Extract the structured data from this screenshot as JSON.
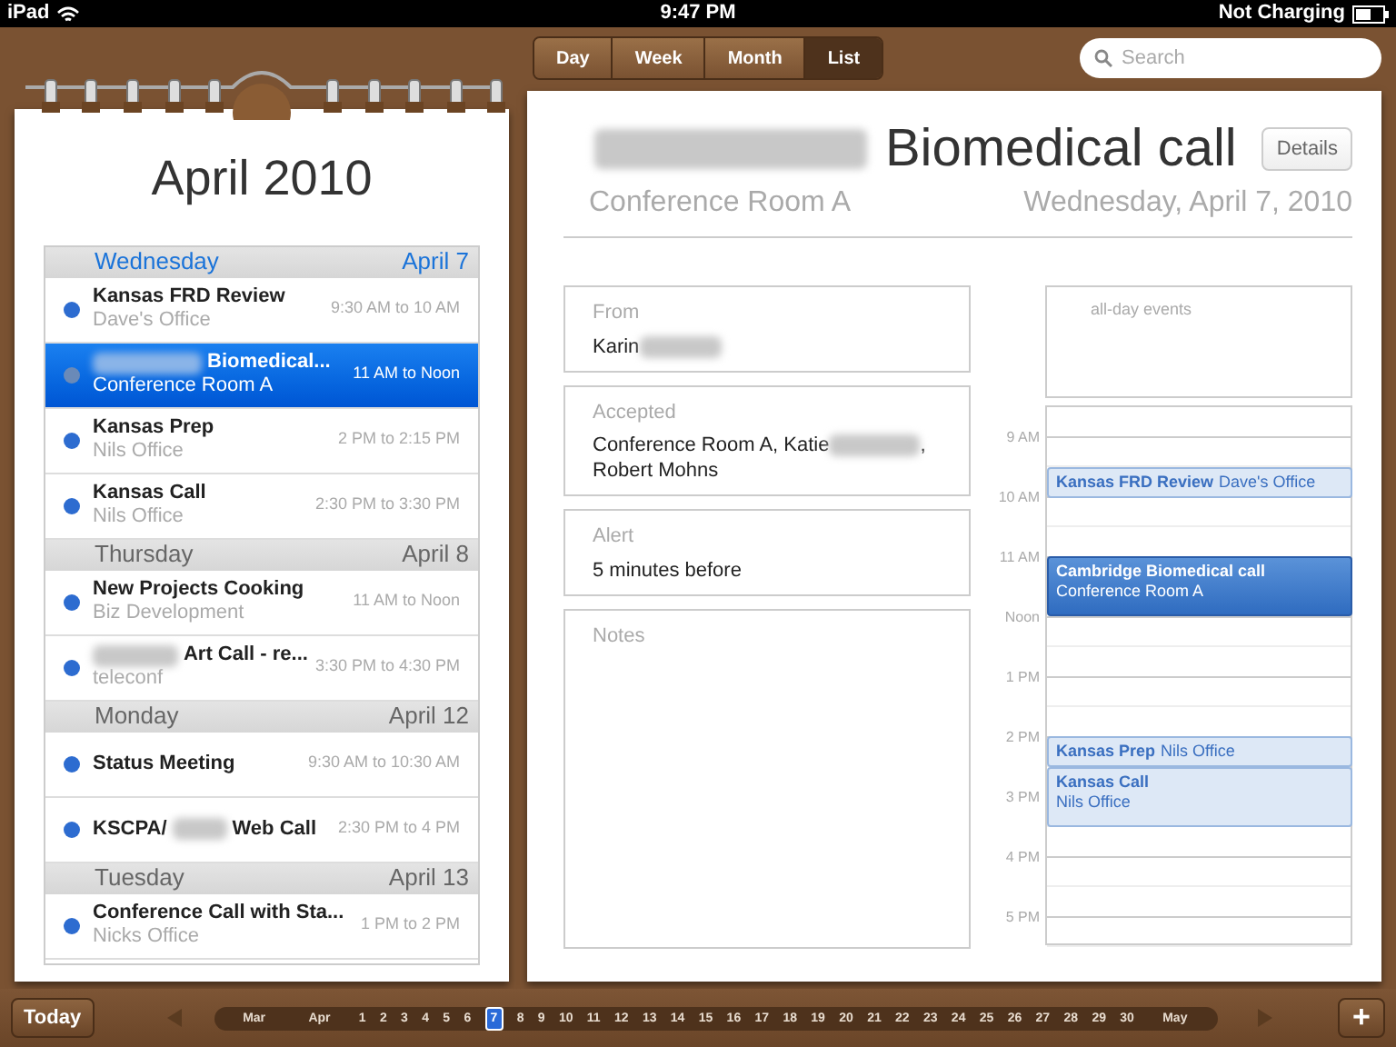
{
  "status_bar": {
    "device": "iPad",
    "time": "9:47 PM",
    "battery": "Not Charging"
  },
  "view_tabs": [
    {
      "label": "Day",
      "selected": false
    },
    {
      "label": "Week",
      "selected": false
    },
    {
      "label": "Month",
      "selected": false
    },
    {
      "label": "List",
      "selected": true
    }
  ],
  "search": {
    "placeholder": "Search"
  },
  "list_page": {
    "title": "April 2010",
    "days": [
      {
        "weekday": "Wednesday",
        "date": "April 7",
        "today": true,
        "events": [
          {
            "title_segments": [
              "Kansas FRD Review"
            ],
            "blur_before": false,
            "location": "Dave's Office",
            "time": "9:30 AM to 10 AM",
            "selected": false
          },
          {
            "title_segments": [
              "Biomedical..."
            ],
            "blur_before": true,
            "location": "Conference Room A",
            "time": "11 AM to Noon",
            "selected": true
          },
          {
            "title_segments": [
              "Kansas Prep"
            ],
            "blur_before": false,
            "location": "Nils Office",
            "time": "2 PM to 2:15 PM",
            "selected": false
          },
          {
            "title_segments": [
              "Kansas Call"
            ],
            "blur_before": false,
            "location": "Nils Office",
            "time": "2:30 PM to 3:30 PM",
            "selected": false
          }
        ]
      },
      {
        "weekday": "Thursday",
        "date": "April 8",
        "today": false,
        "events": [
          {
            "title_segments": [
              "New Projects Cooking"
            ],
            "blur_before": false,
            "location": "Biz Development",
            "time": "11 AM to Noon",
            "selected": false
          },
          {
            "title_segments": [
              "Art Call - re..."
            ],
            "blur_before": true,
            "location": "teleconf",
            "time": "3:30 PM to 4:30 PM",
            "selected": false
          }
        ]
      },
      {
        "weekday": "Monday",
        "date": "April 12",
        "today": false,
        "events": [
          {
            "title_segments": [
              "Status Meeting"
            ],
            "blur_before": false,
            "time": "9:30 AM to 10:30 AM",
            "selected": false
          },
          {
            "title_segments": [
              "KSCPA/",
              "Web Call"
            ],
            "blur_before": false,
            "time": "2:30 PM to 4 PM",
            "selected": false
          }
        ]
      },
      {
        "weekday": "Tuesday",
        "date": "April 13",
        "today": false,
        "events": [
          {
            "title_segments": [
              "Conference Call with Sta..."
            ],
            "blur_before": false,
            "location": "Nicks Office",
            "time": "1 PM to 2 PM",
            "selected": false
          }
        ]
      }
    ]
  },
  "detail": {
    "title": "Biomedical call",
    "title_blur_before": true,
    "details_button": "Details",
    "location": "Conference Room A",
    "date": "Wednesday, April 7, 2010",
    "fields": [
      {
        "label": "From",
        "lines": [
          {
            "segments": [
              "Karin"
            ],
            "blur_after": true
          }
        ]
      },
      {
        "label": "Accepted",
        "lines": [
          {
            "segments": [
              "Conference Room A, Katie",
              ","
            ]
          },
          {
            "segments": [
              "Robert Mohns"
            ]
          }
        ]
      },
      {
        "label": "Alert",
        "lines": [
          {
            "segments": [
              "5 minutes before"
            ]
          }
        ]
      },
      {
        "label": "Notes"
      }
    ]
  },
  "day_view": {
    "all_day_label": "all-day events",
    "hours": [
      "9 AM",
      "10 AM",
      "11 AM",
      "Noon",
      "1 PM",
      "2 PM",
      "3 PM",
      "4 PM",
      "5 PM"
    ],
    "events": [
      {
        "title": "Kansas FRD Review",
        "location": "Dave's Office",
        "kind": "short",
        "selected": false
      },
      {
        "title": "Cambridge Biomedical call",
        "location": "Conference Room A",
        "kind": "long",
        "selected": true
      },
      {
        "title": "Kansas Prep",
        "location": "Nils Office",
        "kind": "short",
        "selected": false
      },
      {
        "title": "Kansas Call",
        "location": "Nils Office",
        "kind": "long",
        "selected": false
      }
    ]
  },
  "bottom_bar": {
    "today_button": "Today",
    "dates": [
      {
        "label": "Mar",
        "selected": false
      },
      {
        "label": "Apr",
        "selected": false
      },
      {
        "label": "1",
        "selected": false
      },
      {
        "label": "2",
        "selected": false
      },
      {
        "label": "3",
        "selected": false
      },
      {
        "label": "4",
        "selected": false
      },
      {
        "label": "5",
        "selected": false
      },
      {
        "label": "6",
        "selected": false
      },
      {
        "label": "7",
        "selected": true
      },
      {
        "label": "8",
        "selected": false
      },
      {
        "label": "9",
        "selected": false
      },
      {
        "label": "10",
        "selected": false
      },
      {
        "label": "11",
        "selected": false
      },
      {
        "label": "12",
        "selected": false
      },
      {
        "label": "13",
        "selected": false
      },
      {
        "label": "14",
        "selected": false
      },
      {
        "label": "15",
        "selected": false
      },
      {
        "label": "16",
        "selected": false
      },
      {
        "label": "17",
        "selected": false
      },
      {
        "label": "18",
        "selected": false
      },
      {
        "label": "19",
        "selected": false
      },
      {
        "label": "20",
        "selected": false
      },
      {
        "label": "21",
        "selected": false
      },
      {
        "label": "22",
        "selected": false
      },
      {
        "label": "23",
        "selected": false
      },
      {
        "label": "24",
        "selected": false
      },
      {
        "label": "25",
        "selected": false
      },
      {
        "label": "26",
        "selected": false
      },
      {
        "label": "27",
        "selected": false
      },
      {
        "label": "28",
        "selected": false
      },
      {
        "label": "29",
        "selected": false
      },
      {
        "label": "30",
        "selected": false
      },
      {
        "label": "May",
        "selected": false
      }
    ],
    "add_button": "+"
  }
}
